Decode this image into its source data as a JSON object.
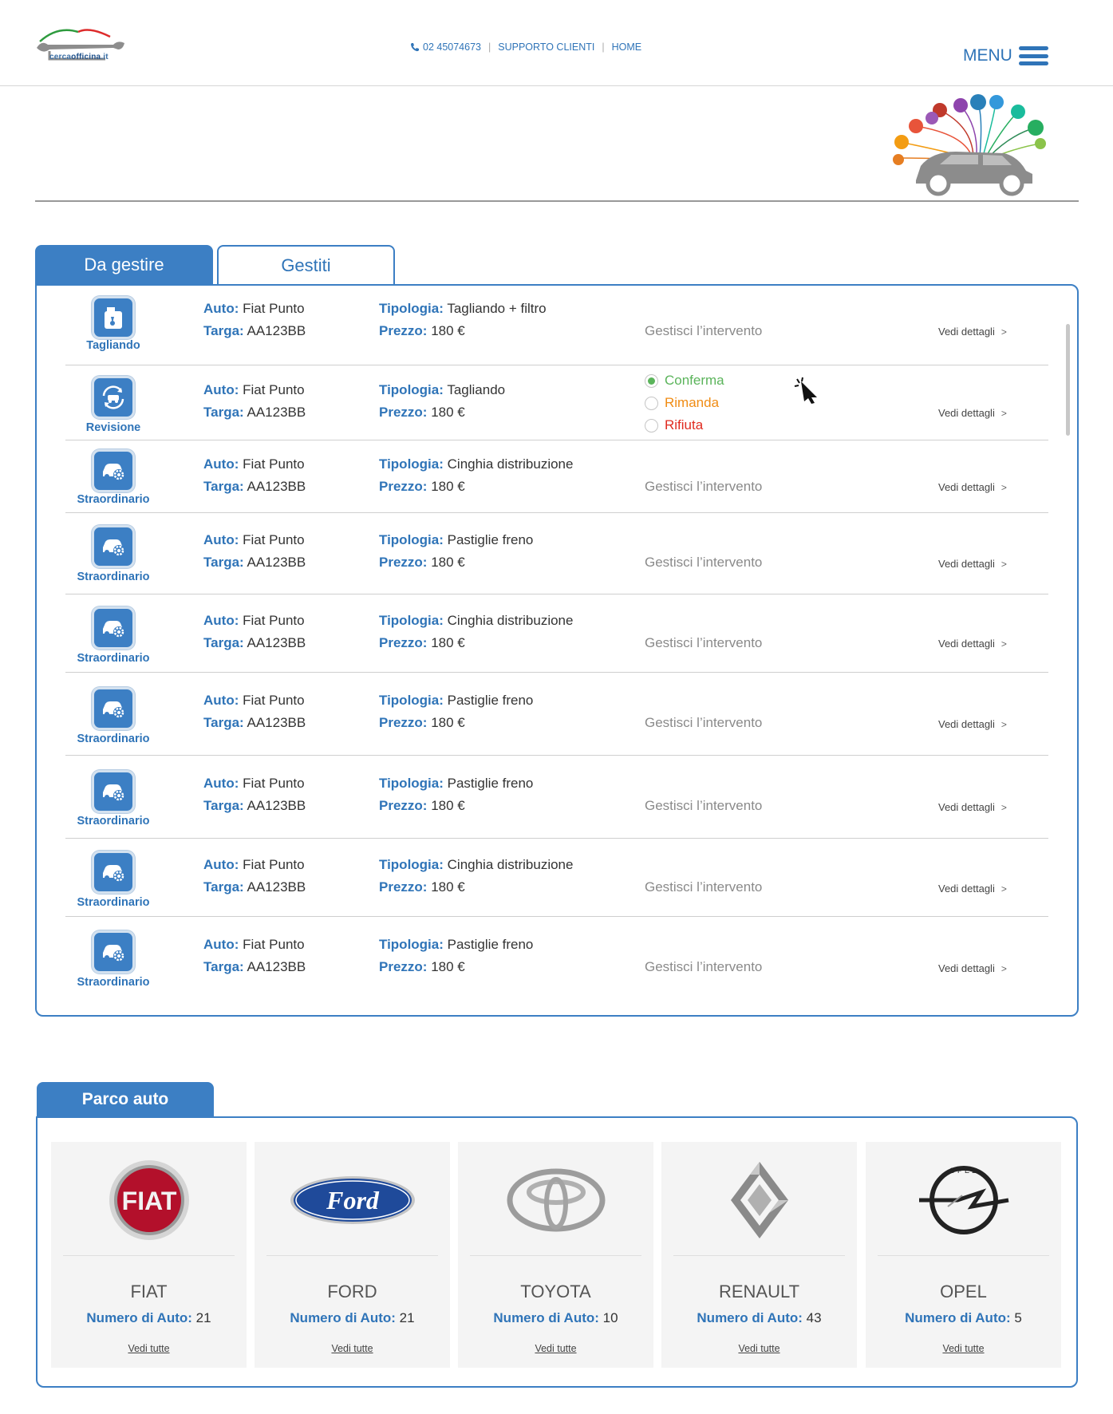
{
  "header": {
    "logo_text_prefix": "cerca",
    "logo_text_brand": "officina",
    "logo_text_suffix": ".it",
    "phone": "02 45074673",
    "support": "SUPPORTO CLIENTI",
    "home": "HOME",
    "menu": "MENU",
    "accent_color": "#3c7fc4"
  },
  "tabs": [
    {
      "label": "Da gestire",
      "active": true
    },
    {
      "label": "Gestiti",
      "active": false
    }
  ],
  "labels": {
    "auto": "Auto:",
    "targa": "Targa:",
    "tipologia": "Tipologia:",
    "prezzo": "Prezzo:",
    "gestisci": "Gestisci l’intervento",
    "vedi": "Vedi dettagli",
    "chevron": ">"
  },
  "rows": [
    {
      "type": "Tagliando",
      "icon": "oil-can-icon",
      "auto": "Fiat Punto",
      "targa": "AA123BB",
      "tipologia": "Tagliando + filtro",
      "prezzo": "180 €"
    },
    {
      "type": "Revisione",
      "icon": "car-rotate-icon",
      "auto": "Fiat Punto",
      "targa": "AA123BB",
      "tipologia": "Tagliando",
      "prezzo": "180 €",
      "options": [
        {
          "label": "Conferma",
          "color": "#5bb45b",
          "checked": true
        },
        {
          "label": "Rimanda",
          "color": "#f08c14",
          "checked": false
        },
        {
          "label": "Rifiuta",
          "color": "#e02b20",
          "checked": false
        }
      ]
    },
    {
      "type": "Straordinario",
      "icon": "car-gear-icon",
      "auto": "Fiat Punto",
      "targa": "AA123BB",
      "tipologia": "Cinghia distribuzione",
      "prezzo": "180 €"
    },
    {
      "type": "Straordinario",
      "icon": "car-gear-icon",
      "auto": "Fiat Punto",
      "targa": "AA123BB",
      "tipologia": "Pastiglie freno",
      "prezzo": "180 €"
    },
    {
      "type": "Straordinario",
      "icon": "car-gear-icon",
      "auto": "Fiat Punto",
      "targa": "AA123BB",
      "tipologia": "Cinghia distribuzione",
      "prezzo": "180 €"
    },
    {
      "type": "Straordinario",
      "icon": "car-gear-icon",
      "auto": "Fiat Punto",
      "targa": "AA123BB",
      "tipologia": "Pastiglie freno",
      "prezzo": "180 €"
    },
    {
      "type": "Straordinario",
      "icon": "car-gear-icon",
      "auto": "Fiat Punto",
      "targa": "AA123BB",
      "tipologia": "Pastiglie freno",
      "prezzo": "180 €"
    },
    {
      "type": "Straordinario",
      "icon": "car-gear-icon",
      "auto": "Fiat Punto",
      "targa": "AA123BB",
      "tipologia": "Cinghia distribuzione",
      "prezzo": "180 €"
    },
    {
      "type": "Straordinario",
      "icon": "car-gear-icon",
      "auto": "Fiat Punto",
      "targa": "AA123BB",
      "tipologia": "Pastiglie freno",
      "prezzo": "180 €"
    }
  ],
  "parco": {
    "title": "Parco auto",
    "count_label": "Numero di Auto:",
    "link_label": "Vedi tutte",
    "brands": [
      {
        "name": "FIAT",
        "count": "21",
        "logo": "fiat-logo-icon",
        "logo_text": "FIAT"
      },
      {
        "name": "FORD",
        "count": "21",
        "logo": "ford-logo-icon",
        "logo_text": "Ford"
      },
      {
        "name": "TOYOTA",
        "count": "10",
        "logo": "toyota-logo-icon"
      },
      {
        "name": "RENAULT",
        "count": "43",
        "logo": "renault-logo-icon"
      },
      {
        "name": "OPEL",
        "count": "5",
        "logo": "opel-logo-icon",
        "logo_text": "OPEL"
      }
    ]
  }
}
